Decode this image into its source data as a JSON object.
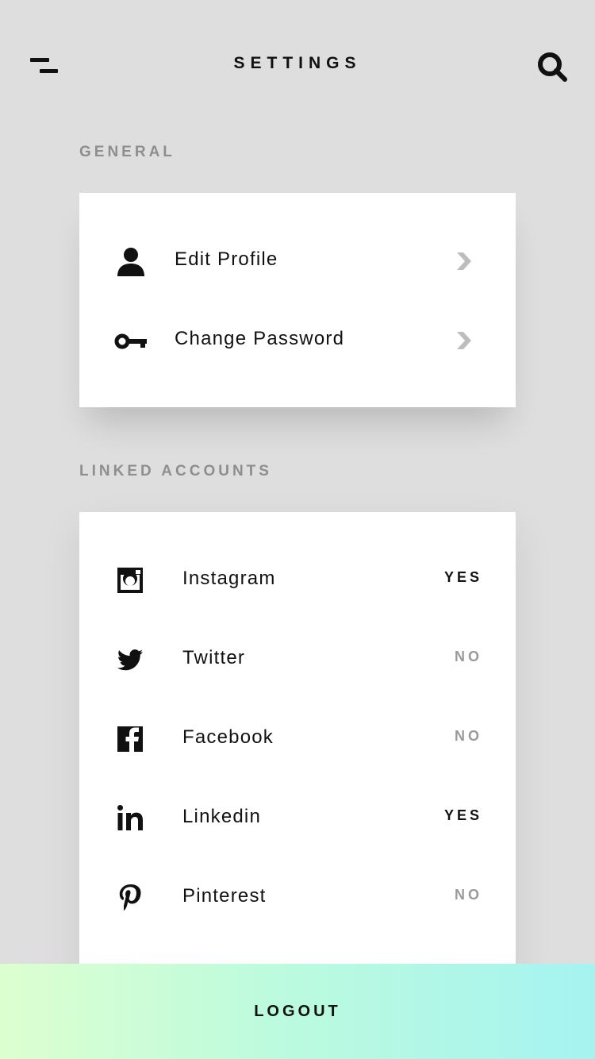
{
  "header": {
    "title": "SETTINGS",
    "menu_icon": "menu-icon",
    "search_icon": "search-icon"
  },
  "general": {
    "heading": "GENERAL",
    "items": [
      {
        "label": "Edit Profile",
        "icon": "person-icon"
      },
      {
        "label": "Change Password",
        "icon": "key-icon"
      }
    ]
  },
  "linked": {
    "heading": "LINKED ACCOUNTS",
    "items": [
      {
        "label": "Instagram",
        "icon": "instagram-icon",
        "status": "YES"
      },
      {
        "label": "Twitter",
        "icon": "twitter-icon",
        "status": "NO"
      },
      {
        "label": "Facebook",
        "icon": "facebook-icon",
        "status": "NO"
      },
      {
        "label": "Linkedin",
        "icon": "linkedin-icon",
        "status": "YES"
      },
      {
        "label": "Pinterest",
        "icon": "pinterest-icon",
        "status": "NO"
      }
    ]
  },
  "footer": {
    "logout_label": "LOGOUT"
  },
  "colors": {
    "background": "#dedede",
    "card": "#ffffff",
    "text": "#111111",
    "muted": "#8e8e8e",
    "gradient_start": "#ddffd0",
    "gradient_end": "#a5f3f1"
  }
}
